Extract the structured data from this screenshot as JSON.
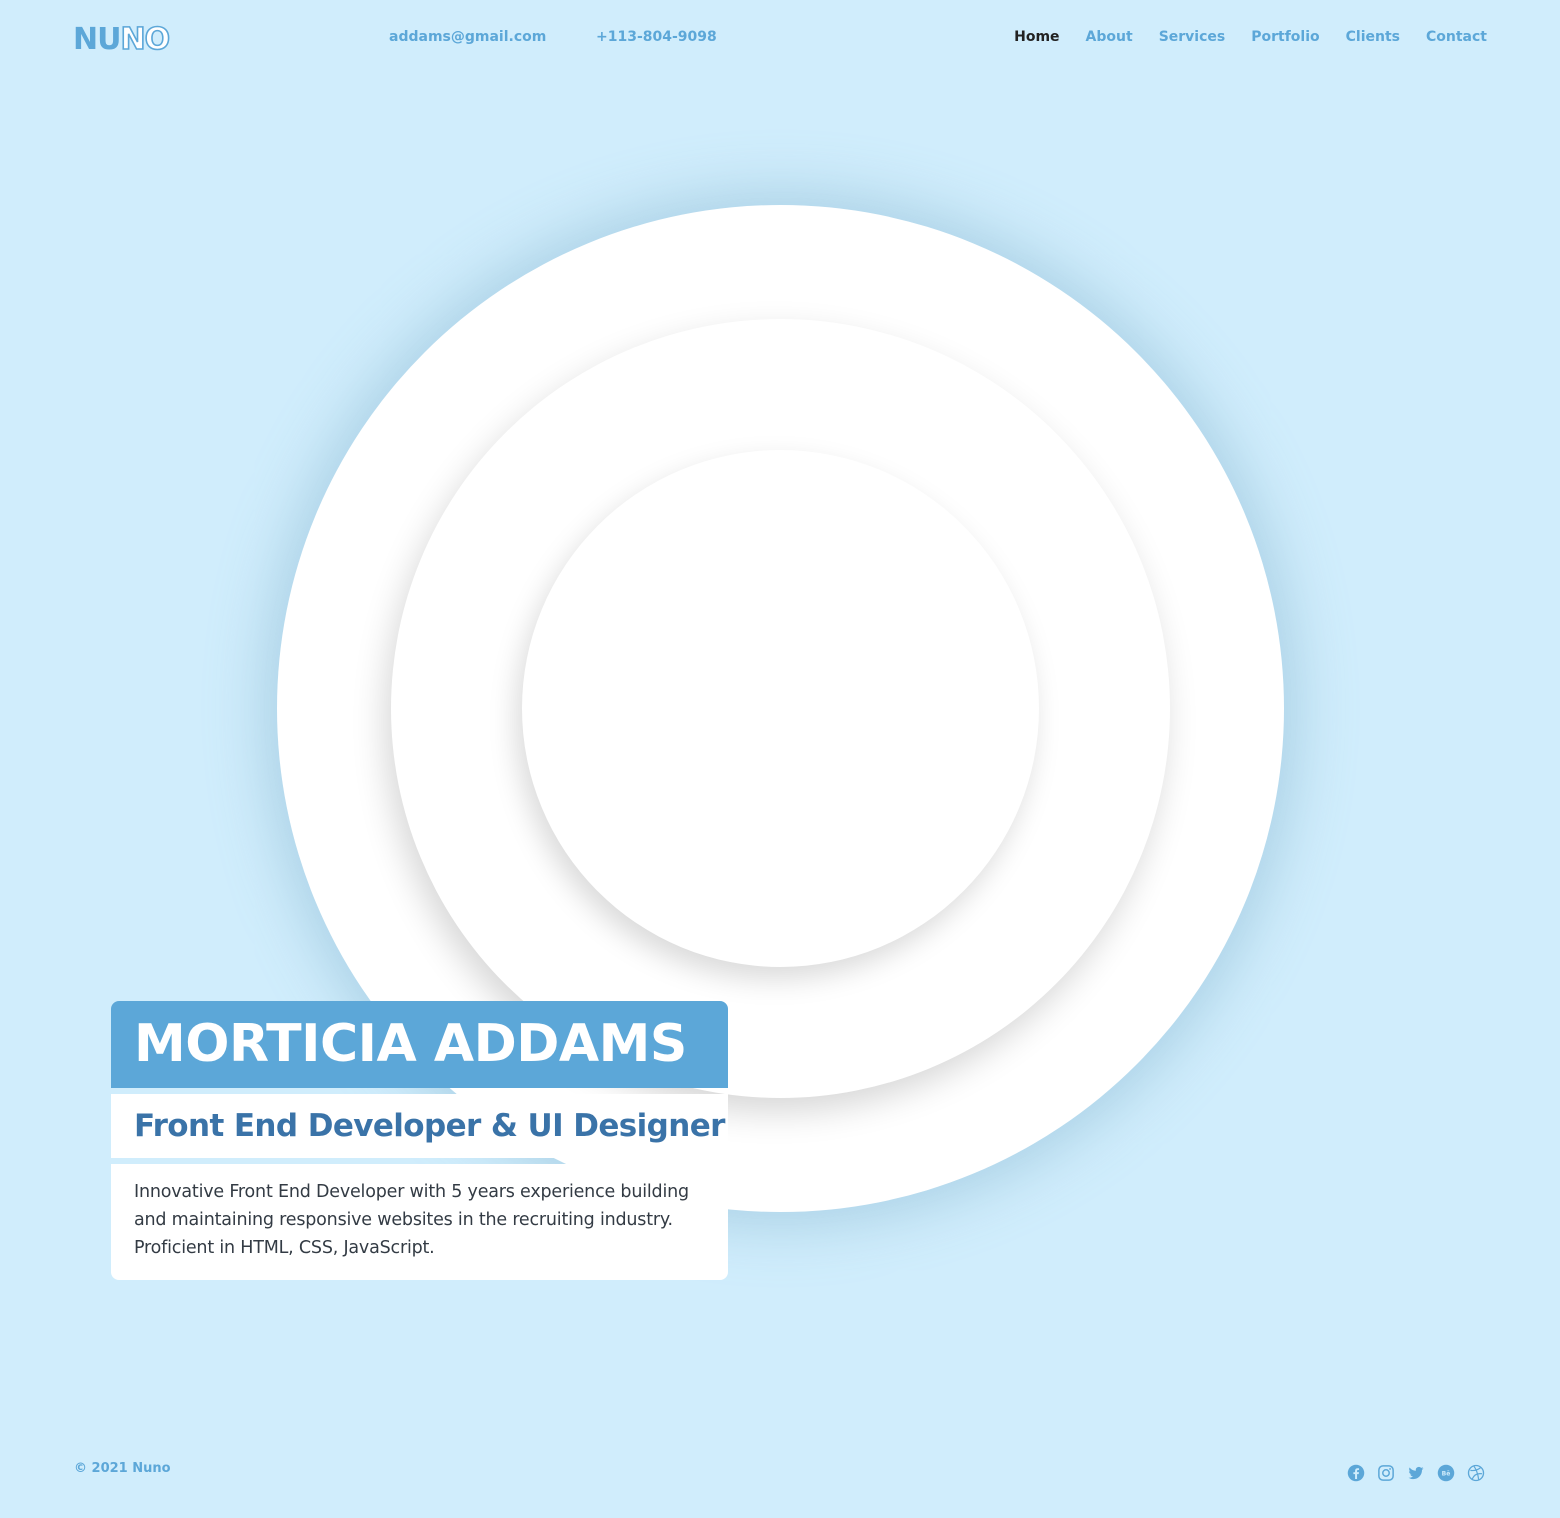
{
  "header": {
    "logo_solid": "NU",
    "logo_outline": "NO",
    "email": "addams@gmail.com",
    "phone": "+113-804-9098"
  },
  "nav": {
    "items": [
      "Home",
      "About",
      "Services",
      "Portfolio",
      "Clients",
      "Contact"
    ],
    "active": "Home"
  },
  "hero": {
    "name": "MORTICIA ADDAMS",
    "role": "Front End Developer & UI Designer",
    "description": "Innovative Front End Developer with 5 years experience building and maintaining responsive websites in the recruiting industry. Proficient in HTML, CSS, JavaScript."
  },
  "footer": {
    "copyright": "© 2021 Nuno",
    "socials": [
      "facebook-icon",
      "instagram-icon",
      "twitter-icon",
      "behance-icon",
      "dribbble-icon"
    ]
  },
  "colors": {
    "background": "#d0edfc",
    "accent": "#5ca7d8",
    "heading": "#3a73a8",
    "nav_active": "#222222"
  }
}
